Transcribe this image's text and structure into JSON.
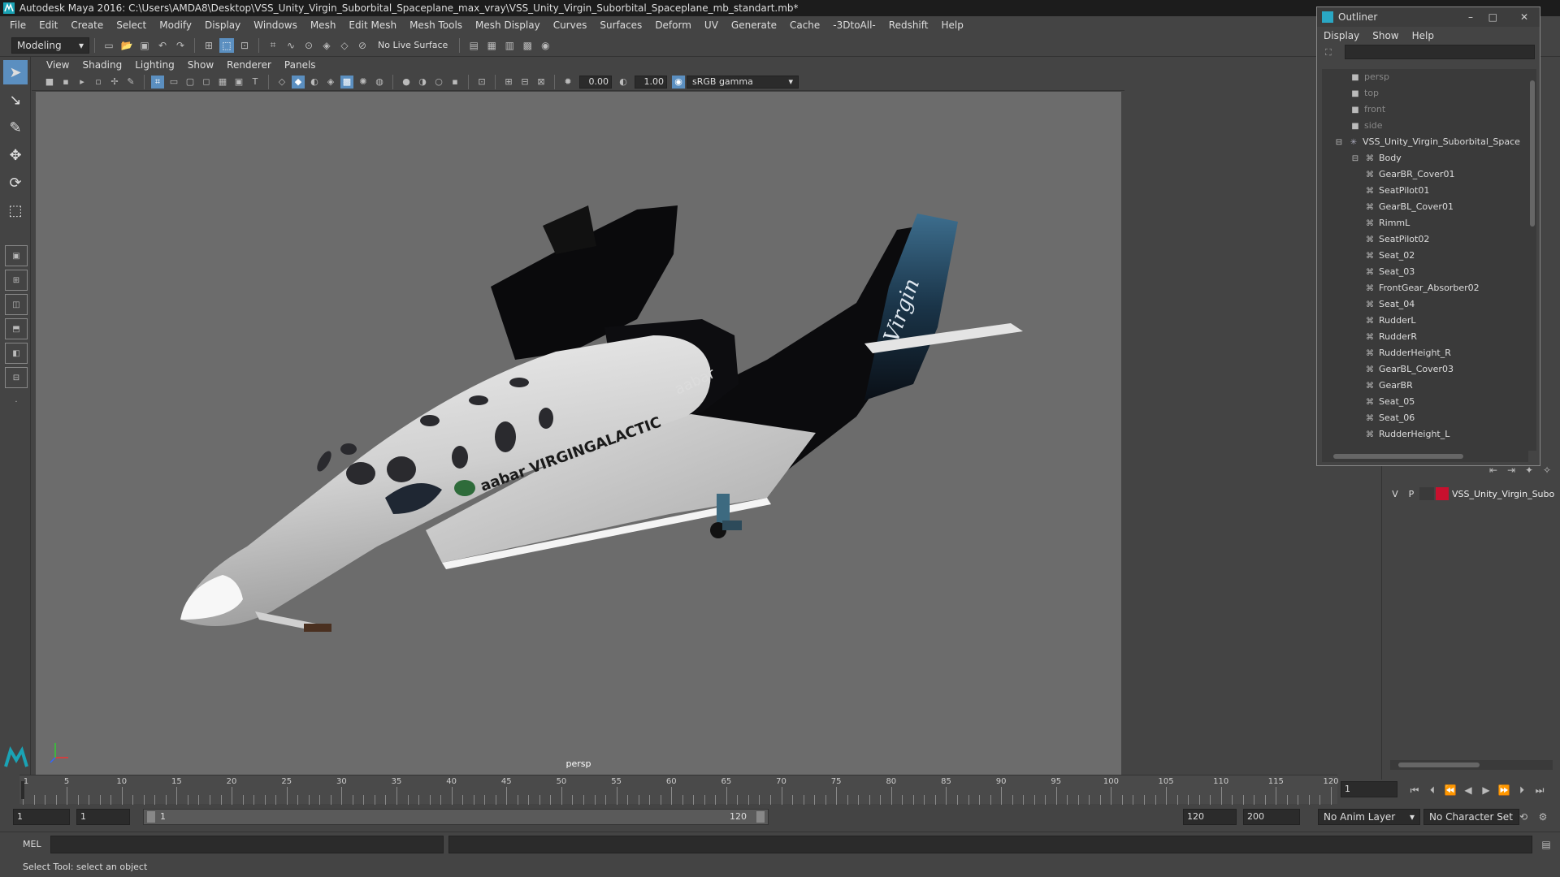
{
  "window": {
    "title": "Autodesk Maya 2016: C:\\Users\\AMDA8\\Desktop\\VSS_Unity_Virgin_Suborbital_Spaceplane_max_vray\\VSS_Unity_Virgin_Suborbital_Spaceplane_mb_standart.mb*"
  },
  "menubar": [
    "File",
    "Edit",
    "Create",
    "Select",
    "Modify",
    "Display",
    "Windows",
    "Mesh",
    "Edit Mesh",
    "Mesh Tools",
    "Mesh Display",
    "Curves",
    "Surfaces",
    "Deform",
    "UV",
    "Generate",
    "Cache",
    "-3DtoAll-",
    "Redshift",
    "Help"
  ],
  "shelf": {
    "mode": "Modeling",
    "live_surface": "No Live Surface"
  },
  "viewport": {
    "menu": [
      "View",
      "Shading",
      "Lighting",
      "Show",
      "Renderer",
      "Panels"
    ],
    "exposure": "0.00",
    "gamma": "1.00",
    "color_space": "sRGB gamma",
    "camera_label": "persp",
    "model_texts": {
      "fuselage": "aabar VIRGINGALACTIC",
      "nacelle": "aabar",
      "tail": "Virgin"
    }
  },
  "outliner": {
    "title": "Outliner",
    "menu": [
      "Display",
      "Show",
      "Help"
    ],
    "cameras": [
      "persp",
      "top",
      "front",
      "side"
    ],
    "root": "VSS_Unity_Virgin_Suborbital_Space",
    "group": "Body",
    "children": [
      "GearBR_Cover01",
      "SeatPilot01",
      "GearBL_Cover01",
      "RimmL",
      "SeatPilot02",
      "Seat_02",
      "Seat_03",
      "FrontGear_Absorber02",
      "Seat_04",
      "RudderL",
      "RudderR",
      "RudderHeight_R",
      "GearBL_Cover03",
      "GearBR",
      "Seat_05",
      "Seat_06",
      "RudderHeight_L"
    ]
  },
  "layer_editor": {
    "v": "V",
    "p": "P",
    "layer_name": "VSS_Unity_Virgin_Subo",
    "layer_color": "#c8102e"
  },
  "timeline": {
    "labels": [
      "1",
      "5",
      "10",
      "15",
      "20",
      "25",
      "30",
      "35",
      "40",
      "45",
      "50",
      "55",
      "60",
      "65",
      "70",
      "75",
      "80",
      "85",
      "90",
      "95",
      "100",
      "105",
      "110",
      "115",
      "120"
    ],
    "current_frame": "1"
  },
  "range": {
    "start": "1",
    "anim_start": "1",
    "slider_start": "1",
    "slider_end": "120",
    "end": "120",
    "anim_end": "200",
    "anim_layer": "No Anim Layer",
    "char_set": "No Character Set"
  },
  "command": {
    "lang": "MEL"
  },
  "help_line": "Select Tool: select an object"
}
